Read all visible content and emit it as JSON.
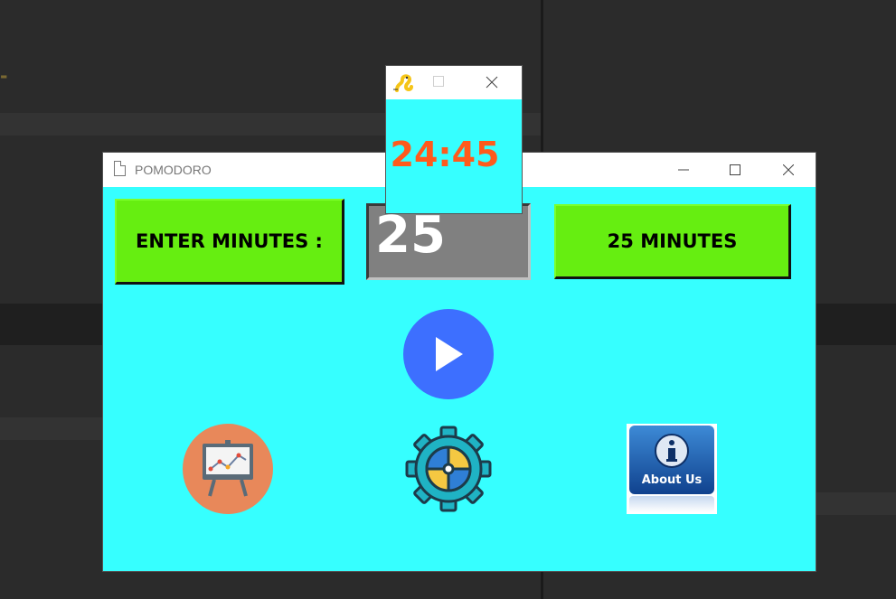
{
  "main_window": {
    "title": "POMODORO",
    "enter_label": "ENTER MINUTES :",
    "minutes_value": "25",
    "preset_label": "25 MINUTES",
    "play_icon": "play-icon",
    "stats_icon": "presentation-chart-icon",
    "settings_icon": "gear-icon",
    "about_label": "About Us",
    "about_icon": "info-icon"
  },
  "timer_window": {
    "readout": "24:45",
    "app_icon": "pygame-snake-icon"
  },
  "colors": {
    "window_bg": "#36ffff",
    "button_green": "#66ee11",
    "play_blue": "#3d6fff",
    "timer_text": "#ff5a1c",
    "input_gray": "#808080"
  }
}
